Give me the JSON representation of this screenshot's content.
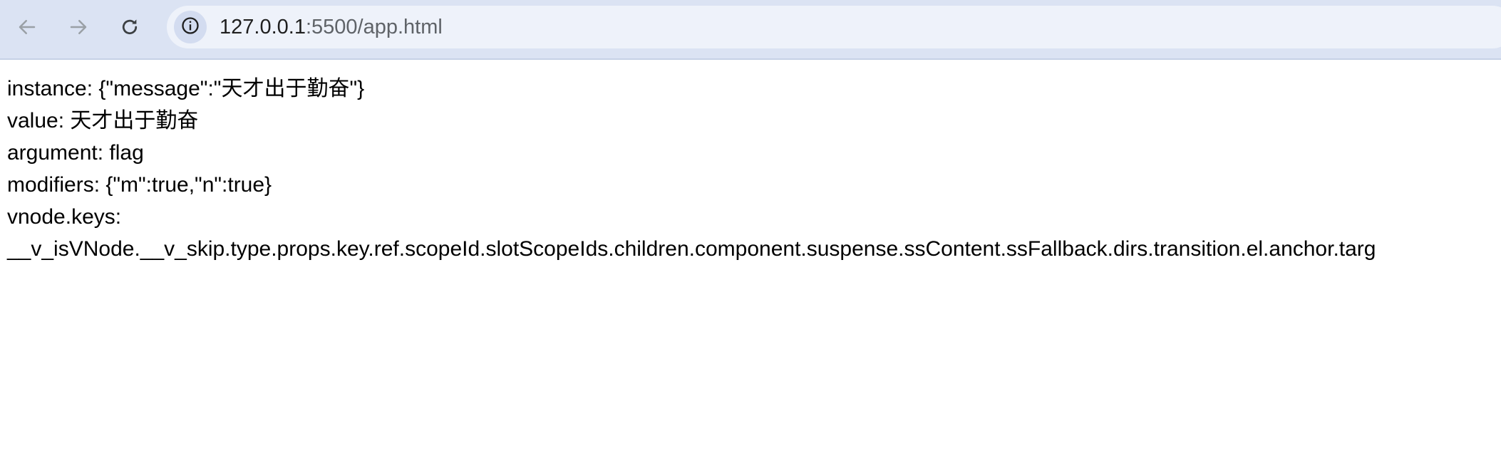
{
  "browser": {
    "url_host": "127.0.0.1",
    "url_rest": ":5500/app.html",
    "icons": {
      "back": "arrow-left-icon",
      "forward": "arrow-right-icon",
      "reload": "reload-icon",
      "site_info": "info-icon"
    }
  },
  "page": {
    "lines": [
      "instance: {\"message\":\"天才出于勤奋\"}",
      "value: 天才出于勤奋",
      "argument: flag",
      "modifiers: {\"m\":true,\"n\":true}",
      "vnode.keys:",
      "__v_isVNode.__v_skip.type.props.key.ref.scopeId.slotScopeIds.children.component.suspense.ssContent.ssFallback.dirs.transition.el.anchor.targ"
    ]
  }
}
